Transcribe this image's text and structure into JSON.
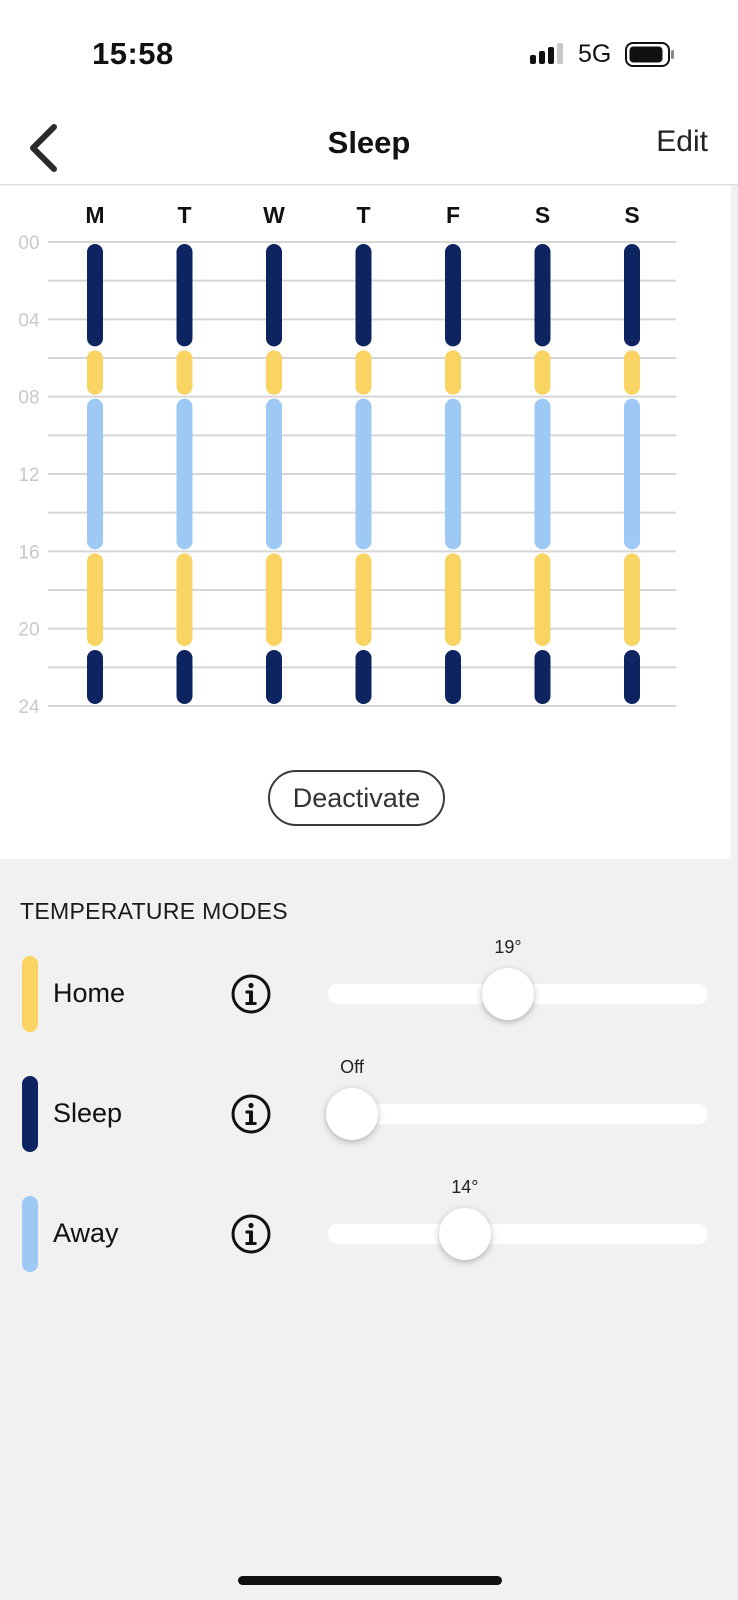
{
  "status_bar": {
    "time": "15:58",
    "network": "5G",
    "icons": [
      "signal-icon",
      "battery-icon"
    ]
  },
  "nav": {
    "back_icon": "chevron-left-icon",
    "title": "Sleep",
    "edit_label": "Edit"
  },
  "schedule": {
    "days": [
      "M",
      "T",
      "W",
      "T",
      "F",
      "S",
      "S"
    ],
    "hour_labels": [
      "00",
      "04",
      "08",
      "12",
      "16",
      "20",
      "24"
    ],
    "hour_max": 24,
    "segments": [
      {
        "mode": "sleep",
        "start": 0,
        "end": 5.5
      },
      {
        "mode": "home",
        "start": 5.5,
        "end": 8
      },
      {
        "mode": "away",
        "start": 8,
        "end": 16
      },
      {
        "mode": "home",
        "start": 16,
        "end": 21
      },
      {
        "mode": "sleep",
        "start": 21,
        "end": 24
      }
    ],
    "colors": {
      "sleep": "#0d2461",
      "home": "#f9d462",
      "away": "#9ec9f5",
      "grid": "#d6d6d6",
      "hour_label": "#c9c9c9"
    },
    "deactivate_label": "Deactivate"
  },
  "modes": {
    "heading": "TEMPERATURE MODES",
    "info_icon": "info-icon",
    "items": [
      {
        "key": "home",
        "label": "Home",
        "color": "#f9d462",
        "value_label": "19°",
        "level": 0.47
      },
      {
        "key": "sleep",
        "label": "Sleep",
        "color": "#0d2461",
        "value_label": "Off",
        "level": 0.0
      },
      {
        "key": "away",
        "label": "Away",
        "color": "#9ec9f5",
        "value_label": "14°",
        "level": 0.34
      }
    ]
  }
}
